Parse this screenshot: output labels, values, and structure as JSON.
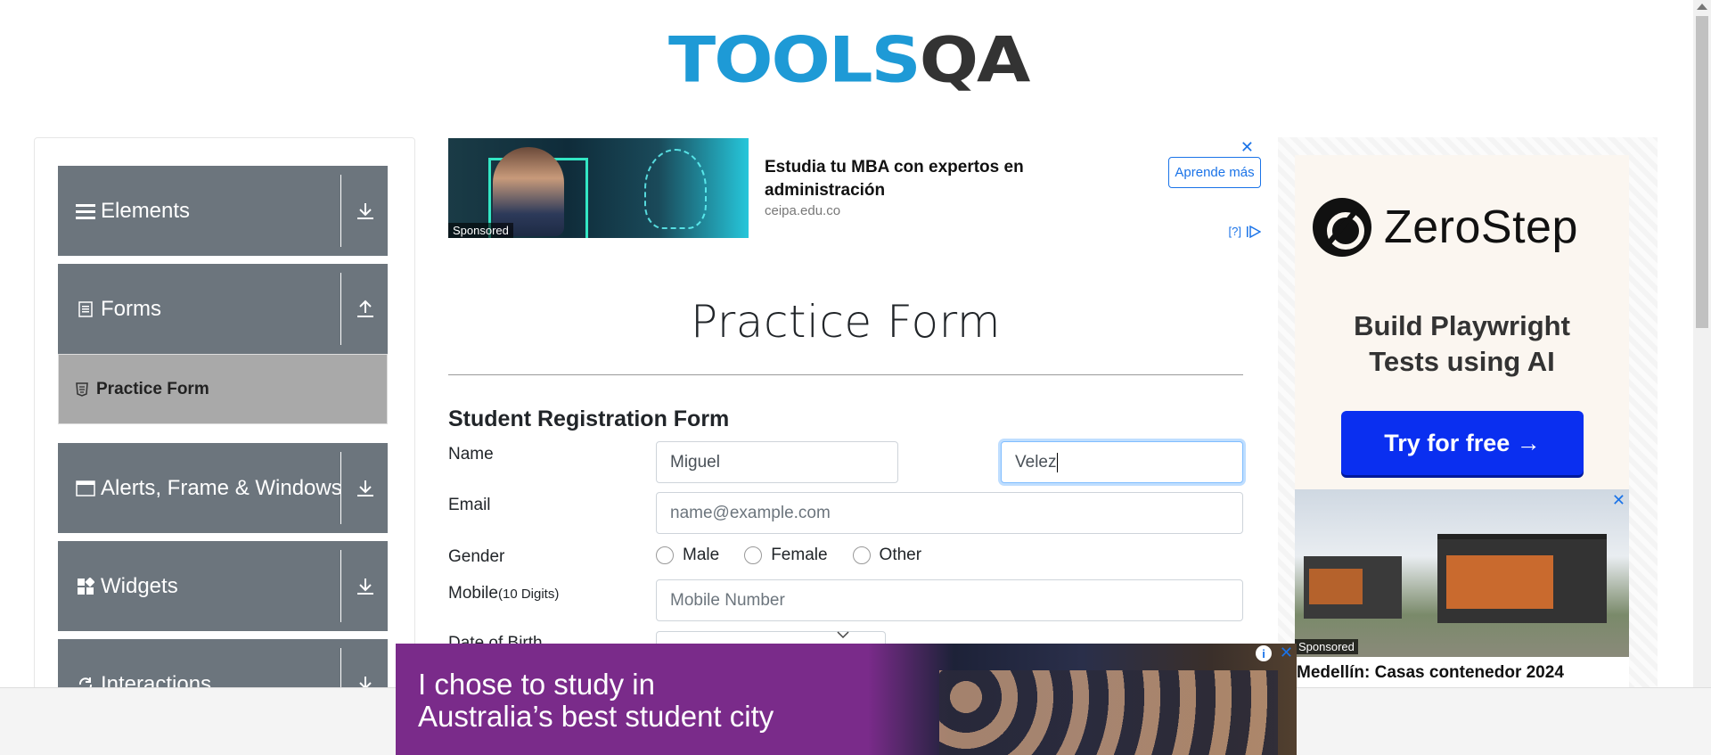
{
  "logo": {
    "text_tools": "TOOLS",
    "text_qa": "QA"
  },
  "sidebar": {
    "groups": [
      {
        "label": "Elements",
        "icon": "hamburger-icon",
        "arrow": "download-arrow-icon"
      },
      {
        "label": "Forms",
        "icon": "document-icon",
        "arrow": "upload-arrow-icon"
      },
      {
        "label": "Alerts, Frame & Windows",
        "icon": "window-icon",
        "arrow": "download-arrow-icon"
      },
      {
        "label": "Widgets",
        "icon": "widgets-icon",
        "arrow": "download-arrow-icon"
      },
      {
        "label": "Interactions",
        "icon": "interactions-icon",
        "arrow": "download-arrow-icon"
      }
    ],
    "active_item": {
      "label": "Practice Form",
      "icon": "html5-icon"
    }
  },
  "top_ad": {
    "sponsored": "Sponsored",
    "title": "Estudia tu MBA con expertos en administración",
    "domain": "ceipa.edu.co",
    "cta": "Aprende más",
    "close": "✕",
    "info": "[?]"
  },
  "form": {
    "title": "Practice Form",
    "subtitle": "Student Registration Form",
    "name_label": "Name",
    "first_name_value": "Miguel",
    "last_name_value": "Velez",
    "email_label": "Email",
    "email_placeholder": "name@example.com",
    "gender_label": "Gender",
    "gender_options": [
      "Male",
      "Female",
      "Other"
    ],
    "mobile_label": "Mobile",
    "mobile_hint": "(10 Digits)",
    "mobile_placeholder": "Mobile Number",
    "dob_label": "Date of Birth"
  },
  "right_ad": {
    "brand": "ZeroStep",
    "tagline_line1": "Build Playwright",
    "tagline_line2": "Tests using AI",
    "cta": "Try for free →",
    "house_sponsored": "Sponsored",
    "house_title": "Medellín: Casas contenedor 2024",
    "house_close": "✕"
  },
  "bottom_ad": {
    "line1": "I chose to study in",
    "line2": "Australia’s best student city",
    "info": "i",
    "close": "✕"
  },
  "colors": {
    "brand_blue": "#1e9ad6",
    "sidebar_gray": "#6c757d",
    "active_gray": "#a9a9a9",
    "zerostep_button": "#0a2ff0",
    "bottom_ad_purple": "#7a2b8a"
  }
}
